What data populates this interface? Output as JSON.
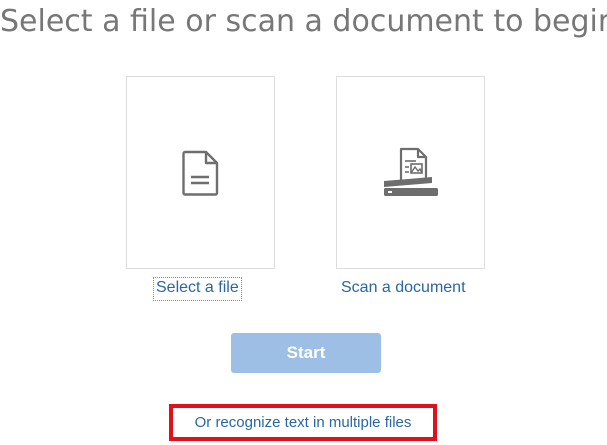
{
  "heading": "Select a file or scan a document to begin",
  "options": {
    "file": {
      "label": "Select a file",
      "icon": "document-icon"
    },
    "scan": {
      "label": "Scan a document",
      "icon": "scanner-icon"
    }
  },
  "start_button": {
    "label": "Start",
    "state": "disabled"
  },
  "multi_files_link": {
    "label": "Or recognize text in multiple files"
  },
  "colors": {
    "heading": "#777777",
    "link": "#2a66a6",
    "start_button_bg": "#9dbfe5",
    "highlight_border": "#e0101c",
    "icon": "#6e6e6e"
  }
}
